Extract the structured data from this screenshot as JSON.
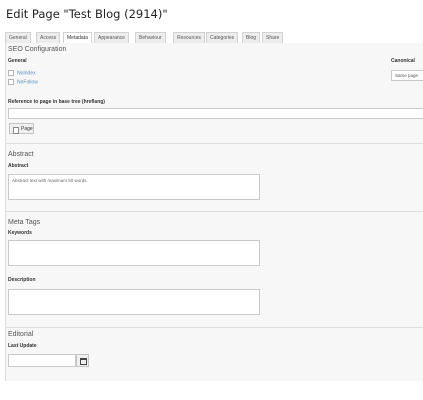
{
  "page": {
    "title": "Edit Page \"Test Blog (2914)\""
  },
  "tabs": [
    {
      "label": "General"
    },
    {
      "label": "Access"
    },
    {
      "label": "Metadata"
    },
    {
      "label": "Appearance"
    },
    {
      "label": "Behaviour"
    },
    {
      "label": "Resources"
    },
    {
      "label": "Categories"
    },
    {
      "label": "Blog"
    },
    {
      "label": "Share"
    }
  ],
  "active_tab": "Metadata",
  "seo": {
    "title": "SEO Configuration",
    "general_label": "General",
    "noindex_label": "NoIndex",
    "nofollow_label": "NoFollow",
    "canonical_label": "Canonical",
    "canonical_value": "Same page",
    "hreflang_label": "Reference to page in base tree (hreflang)",
    "hreflang_value": "",
    "page_button_label": "Page"
  },
  "abstract": {
    "title": "Abstract",
    "label": "Abstract",
    "placeholder": "Abstract text with maximum 50 words."
  },
  "meta_tags": {
    "title": "Meta Tags",
    "keywords_label": "Keywords",
    "keywords_value": "",
    "description_label": "Description",
    "description_value": ""
  },
  "editorial": {
    "title": "Editorial",
    "last_update_label": "Last Update",
    "last_update_value": ""
  },
  "colors": {
    "link": "#5a8fbf",
    "panel_bg": "#f7f7f7",
    "tab_bg": "#ededed"
  }
}
